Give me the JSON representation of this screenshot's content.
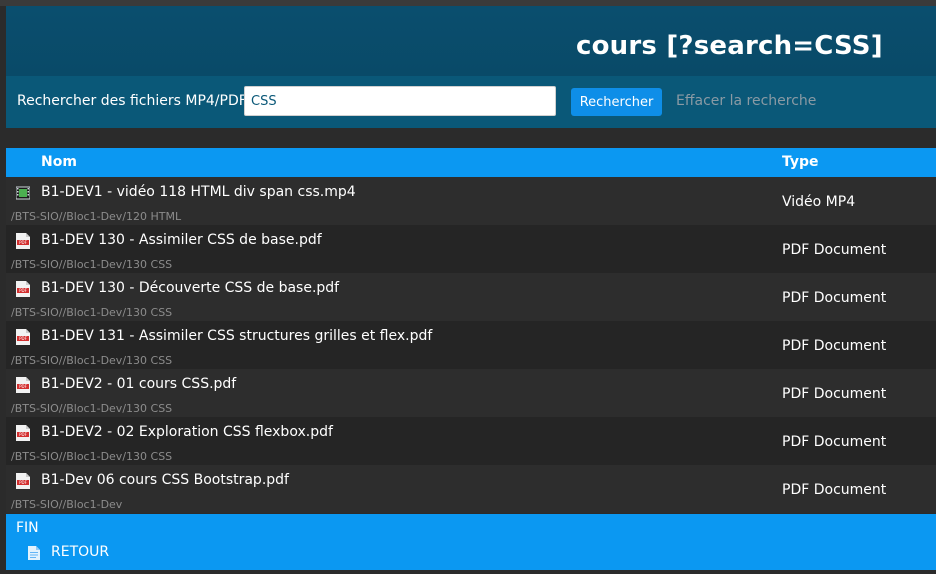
{
  "header": {
    "title": "cours [?search=CSS]"
  },
  "search": {
    "label": "Rechercher des fichiers MP4/PDF :",
    "value": "CSS",
    "button_label": "Rechercher",
    "clear_label": "Effacer la recherche"
  },
  "table": {
    "columns": {
      "name": "Nom",
      "type": "Type"
    },
    "rows": [
      {
        "icon": "video-file-icon",
        "name": "B1-DEV1 - vidéo 118 HTML div span css.mp4",
        "path": "/BTS-SIO//Bloc1-Dev/120 HTML",
        "type": "Vidéo MP4"
      },
      {
        "icon": "pdf-file-icon",
        "name": "B1-DEV 130 - Assimiler CSS de base.pdf",
        "path": "/BTS-SIO//Bloc1-Dev/130 CSS",
        "type": "PDF Document"
      },
      {
        "icon": "pdf-file-icon",
        "name": "B1-DEV 130 - Découverte CSS de base.pdf",
        "path": "/BTS-SIO//Bloc1-Dev/130 CSS",
        "type": "PDF Document"
      },
      {
        "icon": "pdf-file-icon",
        "name": "B1-DEV 131 - Assimiler CSS structures grilles et flex.pdf",
        "path": "/BTS-SIO//Bloc1-Dev/130 CSS",
        "type": "PDF Document"
      },
      {
        "icon": "pdf-file-icon",
        "name": "B1-DEV2 - 01 cours CSS.pdf",
        "path": "/BTS-SIO//Bloc1-Dev/130 CSS",
        "type": "PDF Document"
      },
      {
        "icon": "pdf-file-icon",
        "name": "B1-DEV2 - 02 Exploration CSS flexbox.pdf",
        "path": "/BTS-SIO//Bloc1-Dev/130 CSS",
        "type": "PDF Document"
      },
      {
        "icon": "pdf-file-icon",
        "name": "B1-Dev 06 cours CSS Bootstrap.pdf",
        "path": "/BTS-SIO//Bloc1-Dev",
        "type": "PDF Document"
      }
    ]
  },
  "footer": {
    "end_label": "FIN",
    "back_label": "RETOUR",
    "back_icon": "document-icon"
  },
  "colors": {
    "accent": "#0b98f2",
    "header_bg": "#0a4e6e",
    "search_bg": "#0a5878",
    "button": "#0e8ee8"
  }
}
